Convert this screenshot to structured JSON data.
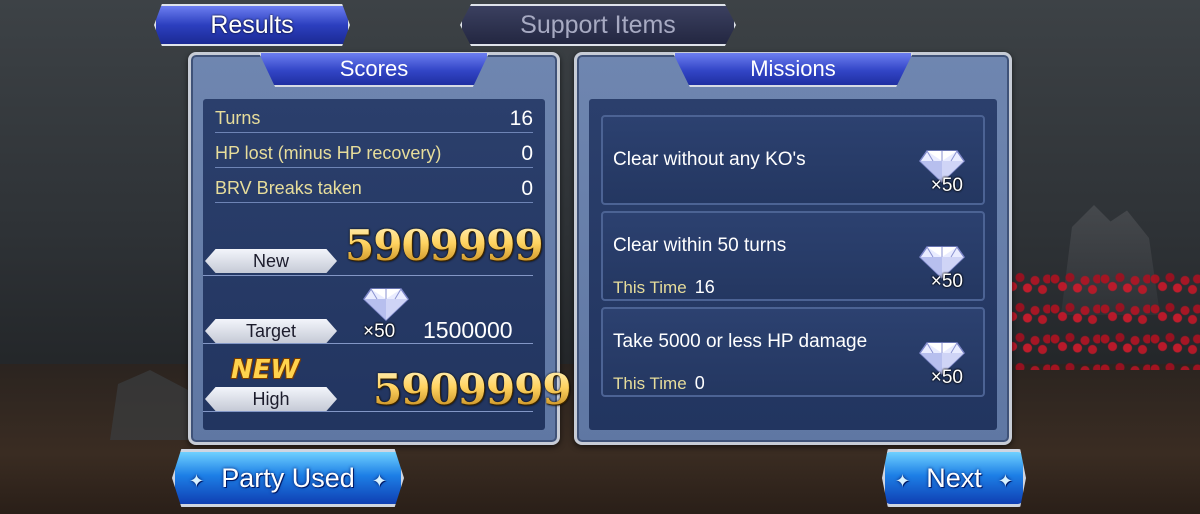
{
  "tabs": {
    "results": "Results",
    "support_items": "Support Items"
  },
  "scores": {
    "header": "Scores",
    "stats": [
      {
        "label": "Turns",
        "value": "16"
      },
      {
        "label": "HP lost (minus HP recovery)",
        "value": "0"
      },
      {
        "label": "BRV Breaks taken",
        "value": "0"
      }
    ],
    "new_label": "New",
    "new_score": "5909999",
    "target_label": "Target",
    "target_reward_count": "×50",
    "target_score": "1500000",
    "new_badge": "NEW",
    "high_label": "High",
    "high_score": "5909999"
  },
  "missions": {
    "header": "Missions",
    "items": [
      {
        "title": "Clear without any KO's",
        "this_time_label": "",
        "this_time_value": "",
        "reward_icon": "crystal-icon",
        "reward_count": "×50"
      },
      {
        "title": "Clear within 50 turns",
        "this_time_label": "This Time",
        "this_time_value": "16",
        "reward_icon": "crystal-icon",
        "reward_count": "×50"
      },
      {
        "title": "Take 5000 or less HP damage",
        "this_time_label": "This Time",
        "this_time_value": "0",
        "reward_icon": "crystal-icon",
        "reward_count": "×50"
      }
    ]
  },
  "buttons": {
    "party_used": "Party Used",
    "next": "Next"
  },
  "colors": {
    "accent_blue": "#2c3fbf",
    "gold": "#ffd361",
    "label_yellow": "#e7dd9b",
    "panel_bg": "#223560"
  }
}
